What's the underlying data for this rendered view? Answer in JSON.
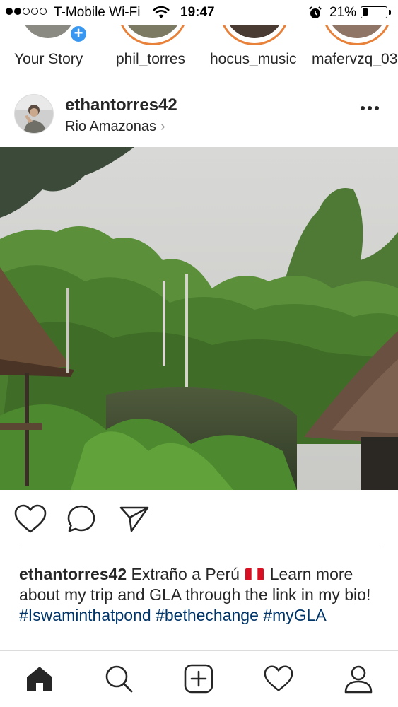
{
  "status_bar": {
    "carrier": "T-Mobile Wi-Fi",
    "time": "19:47",
    "battery_percent": "21%",
    "battery_level": 0.21,
    "signal_bars_filled": 2,
    "signal_bars_total": 5
  },
  "stories": [
    {
      "label": "Your Story",
      "is_own": true
    },
    {
      "label": "phil_torres"
    },
    {
      "label": "hocus_music"
    },
    {
      "label": "mafervzq_03"
    }
  ],
  "post": {
    "username": "ethantorres42",
    "location": "Rio Amazonas",
    "location_chevron": "›",
    "caption": {
      "username": "ethantorres42",
      "text_before_flag": "Extraño a Perú",
      "text_after_flag": "Learn more about my trip and GLA through the link in my bio!",
      "hashtags": [
        "#Iswaminthatpond",
        "#bethechange",
        "#myGLA"
      ]
    }
  },
  "icons": {
    "story_add": "plus-icon",
    "more": "more-dots-icon",
    "like": "heart-icon",
    "comment": "comment-bubble-icon",
    "share": "paper-plane-icon",
    "nav": [
      "home-icon",
      "search-icon",
      "add-post-icon",
      "activity-heart-icon",
      "profile-icon"
    ]
  },
  "colors": {
    "link": "#003569",
    "story_ring": "#e8823b",
    "add_badge": "#3897f0",
    "text": "#262626"
  }
}
